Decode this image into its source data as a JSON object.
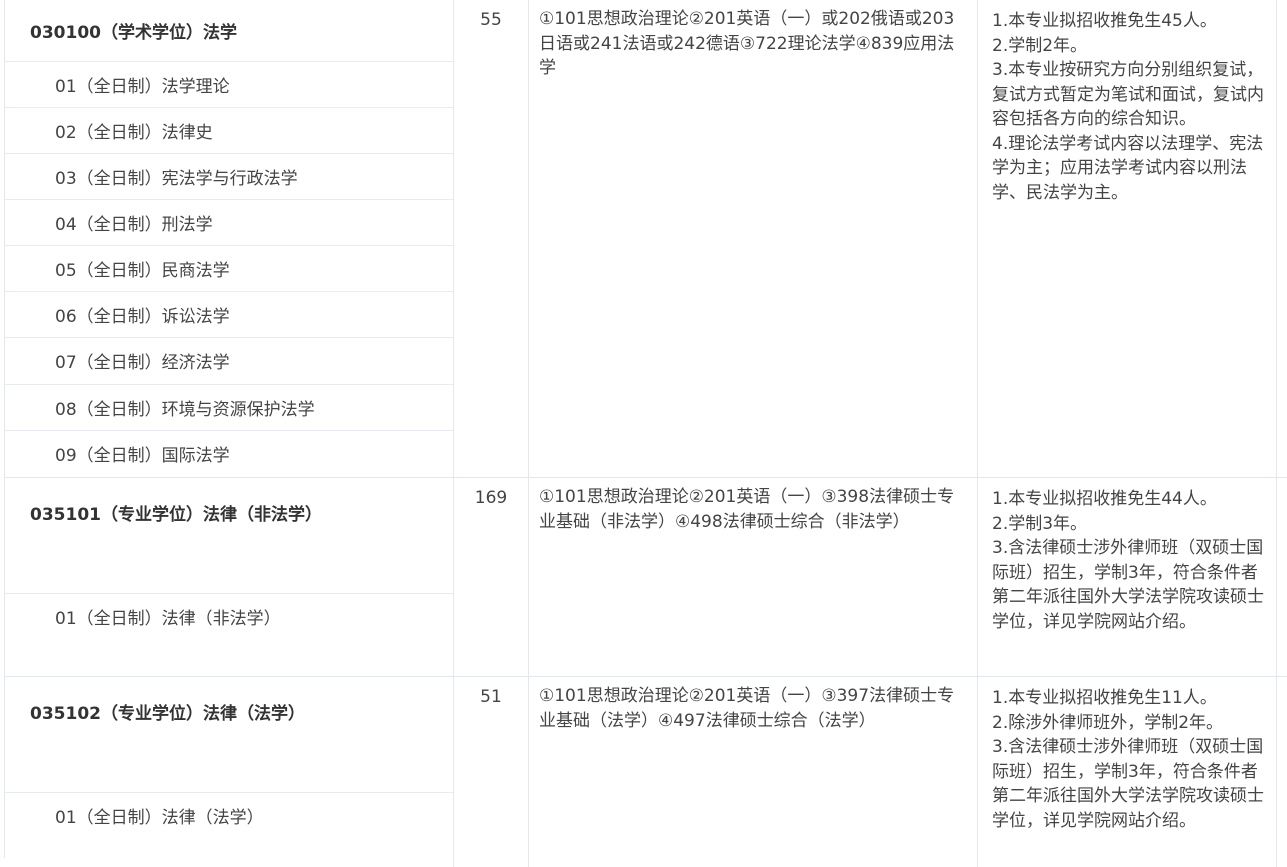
{
  "rows": [
    {
      "major": "030100（学术学位）法学",
      "count": "55",
      "subjects": "①101思想政治理论②201英语（一）或202俄语或203日语或241法语或242德语③722理论法学④839应用法学",
      "notes": [
        "1.本专业拟招收推免生45人。",
        "2.学制2年。",
        "3.本专业按研究方向分别组织复试，复试方式暂定为笔试和面试，复试内容包括各方向的综合知识。",
        "4.理论法学考试内容以法理学、宪法学为主；应用法学考试内容以刑法学、民法学为主。"
      ],
      "directions": [
        "01（全日制）法学理论",
        "02（全日制）法律史",
        "03（全日制）宪法学与行政法学",
        "04（全日制）刑法学",
        "05（全日制）民商法学",
        "06（全日制）诉讼法学",
        "07（全日制）经济法学",
        "08（全日制）环境与资源保护法学",
        "09（全日制）国际法学"
      ]
    },
    {
      "major": "035101（专业学位）法律（非法学）",
      "count": "169",
      "subjects": "①101思想政治理论②201英语（一）③398法律硕士专业基础（非法学）④498法律硕士综合（非法学）",
      "notes": [
        "1.本专业拟招收推免生44人。",
        "2.学制3年。",
        "3.含法律硕士涉外律师班（双硕士国际班）招生，学制3年，符合条件者第二年派往国外大学法学院攻读硕士学位，详见学院网站介绍。"
      ],
      "directions": [
        "01（全日制）法律（非法学）"
      ]
    },
    {
      "major": "035102（专业学位）法律（法学）",
      "count": "51",
      "subjects": "①101思想政治理论②201英语（一）③397法律硕士专业基础（法学）④497法律硕士综合（法学）",
      "notes": [
        "1.本专业拟招收推免生11人。",
        "2.除涉外律师班外，学制2年。",
        "3.含法律硕士涉外律师班（双硕士国际班）招生，学制3年，符合条件者第二年派往国外大学法学院攻读硕士学位，详见学院网站介绍。"
      ],
      "directions": [
        "01（全日制）法律（法学）"
      ]
    }
  ]
}
